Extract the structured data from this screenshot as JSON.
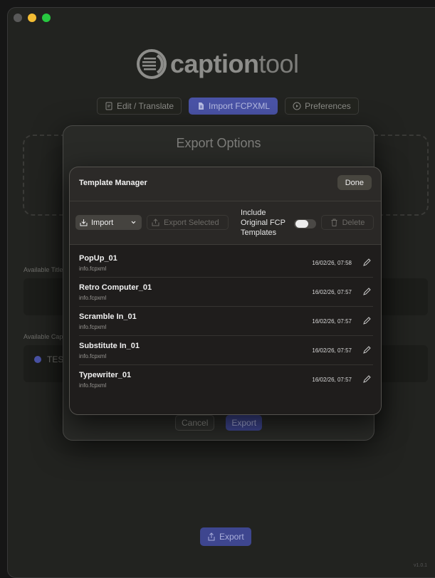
{
  "app": {
    "logo_bold": "caption",
    "logo_light": "tool",
    "version": "v1.0.1"
  },
  "nav": {
    "tabs": [
      {
        "label": "Edit / Translate",
        "icon": "document-edit-icon"
      },
      {
        "label": "Import FCPXML",
        "icon": "file-import-icon",
        "active": true
      },
      {
        "label": "Preferences",
        "icon": "play-circle-icon"
      }
    ]
  },
  "background": {
    "available_titles_label": "Available Titles",
    "available_captions_label": "Available Capt",
    "test_item": "TEST",
    "export_label": "Export"
  },
  "export_options": {
    "title": "Export Options",
    "cancel": "Cancel",
    "export": "Export"
  },
  "template_manager": {
    "title": "Template Manager",
    "done": "Done",
    "toolbar": {
      "import": "Import",
      "export_selected": "Export Selected",
      "include_label": "Include Original FCP Templates",
      "include_enabled": false,
      "delete": "Delete"
    },
    "templates": [
      {
        "name": "PopUp_01",
        "file": "info.fcpxml",
        "date": "16/02/26, 07:58"
      },
      {
        "name": "Retro Computer_01",
        "file": "info.fcpxml",
        "date": "16/02/26, 07:57"
      },
      {
        "name": "Scramble In_01",
        "file": "info.fcpxml",
        "date": "16/02/26, 07:57"
      },
      {
        "name": "Substitute In_01",
        "file": "info.fcpxml",
        "date": "16/02/26, 07:57"
      },
      {
        "name": "Typewriter_01",
        "file": "info.fcpxml",
        "date": "16/02/26, 07:57"
      }
    ]
  },
  "colors": {
    "accent": "#4a53a6",
    "window_bg": "#222320",
    "sheet_bg": "#2c2a28"
  }
}
